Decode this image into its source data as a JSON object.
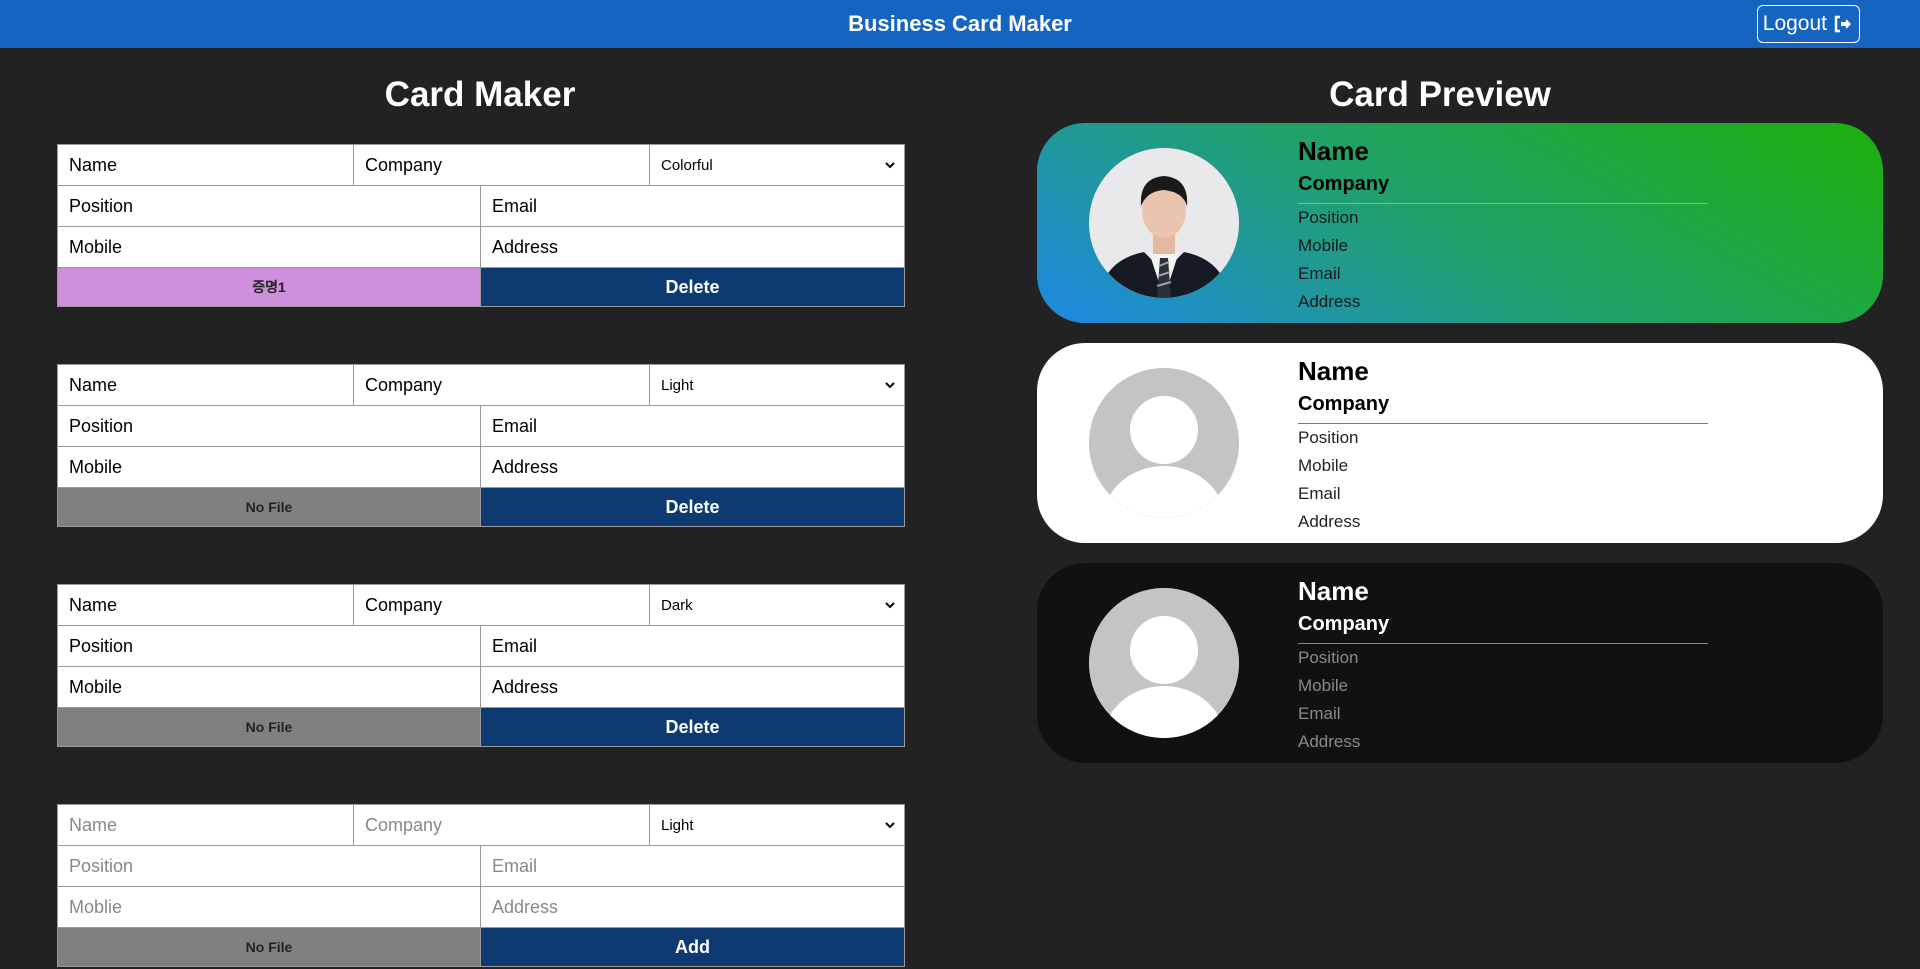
{
  "header": {
    "title": "Business Card Maker",
    "logout_label": "Logout"
  },
  "maker": {
    "title": "Card Maker",
    "cards": [
      {
        "name": "Name",
        "company": "Company",
        "theme": "Colorful",
        "position": "Position",
        "email": "Email",
        "mobile": "Mobile",
        "address": "Address",
        "file": "증명1",
        "action": "Delete"
      },
      {
        "name": "Name",
        "company": "Company",
        "theme": "Light",
        "position": "Position",
        "email": "Email",
        "mobile": "Mobile",
        "address": "Address",
        "file": "No File",
        "action": "Delete"
      },
      {
        "name": "Name",
        "company": "Company",
        "theme": "Dark",
        "position": "Position",
        "email": "Email",
        "mobile": "Mobile",
        "address": "Address",
        "file": "No File",
        "action": "Delete"
      }
    ],
    "add_form": {
      "name_placeholder": "Name",
      "company_placeholder": "Company",
      "theme": "Light",
      "position_placeholder": "Position",
      "email_placeholder": "Email",
      "mobile_placeholder": "Moblie",
      "address_placeholder": "Address",
      "file": "No File",
      "action": "Add"
    }
  },
  "preview": {
    "title": "Card Preview",
    "cards": [
      {
        "theme": "colorful",
        "name": "Name",
        "company": "Company",
        "position": "Position",
        "mobile": "Mobile",
        "email": "Email",
        "address": "Address"
      },
      {
        "theme": "light",
        "name": "Name",
        "company": "Company",
        "position": "Position",
        "mobile": "Mobile",
        "email": "Email",
        "address": "Address"
      },
      {
        "theme": "dark",
        "name": "Name",
        "company": "Company",
        "position": "Position",
        "mobile": "Mobile",
        "email": "Email",
        "address": "Address"
      }
    ]
  },
  "colors": {
    "header": "#1565c0",
    "background": "#222222",
    "action_button": "#0d3a70",
    "file_pink": "#ce8fdc",
    "file_gray": "#808080"
  },
  "icons": {
    "logout": "sign-out-icon",
    "select": "chevron-down-icon",
    "avatar": "default-avatar-icon"
  }
}
